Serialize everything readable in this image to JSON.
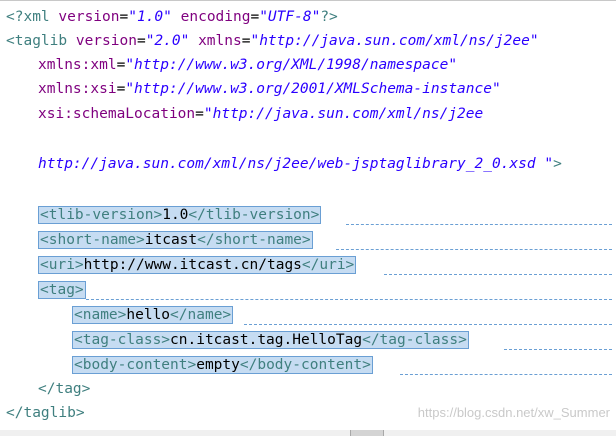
{
  "lines": {
    "l1": {
      "open": "<?xml ",
      "a1": "version",
      "eq1": "=",
      "v1": "\"1.0\"",
      "sp": " ",
      "a2": "encoding",
      "eq2": "=",
      "v2": "\"UTF-8\"",
      "close": "?>"
    },
    "l2": {
      "open": "<taglib ",
      "a1": "version",
      "eq1": "=",
      "v1": "\"2.0\"",
      "sp": " ",
      "a2": "xmlns",
      "eq2": "=",
      "v2": "\"http://java.sun.com/xml/ns/j2ee\""
    },
    "l3": {
      "a": "xmlns:xml",
      "eq": "=",
      "v": "\"http://www.w3.org/XML/1998/namespace\""
    },
    "l4": {
      "a": "xmlns:xsi",
      "eq": "=",
      "v": "\"http://www.w3.org/2001/XMLSchema-instance\""
    },
    "l5": {
      "a": "xsi:schemaLocation",
      "eq": "=",
      "v": "\"http://java.sun.com/xml/ns/j2ee"
    },
    "l6": {
      "v": "http://java.sun.com/xml/ns/j2ee/web-jsptaglibrary_2_0.xsd \"",
      "close": ">"
    },
    "l7": {
      "open": "<tlib-version>",
      "text": "1.0",
      "close": "</tlib-version>"
    },
    "l8": {
      "open": "<short-name>",
      "text": "itcast",
      "close": "</short-name>"
    },
    "l9": {
      "open": "<uri>",
      "text": "http://www.itcast.cn/tags",
      "close": "</uri>"
    },
    "l10": {
      "open": "<tag>"
    },
    "l11": {
      "open": "<name>",
      "text": "hello",
      "close": "</name>"
    },
    "l12": {
      "open": "<tag-class>",
      "text": "cn.itcast.tag.HelloTag",
      "close": "</tag-class>"
    },
    "l13": {
      "open": "<body-content>",
      "text": "empty",
      "close": "</body-content>"
    },
    "l14": {
      "close": "</tag>"
    },
    "l15": {
      "close": "</taglib>"
    }
  },
  "watermark": "https://blog.csdn.net/xw_Summer"
}
